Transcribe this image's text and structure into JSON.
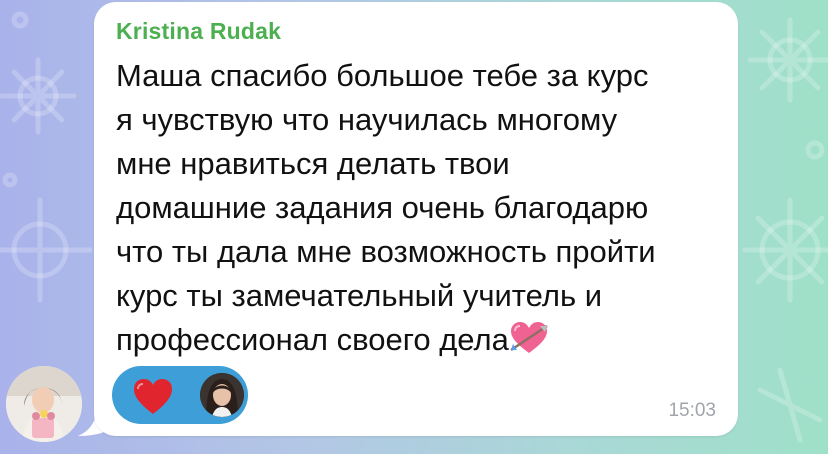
{
  "message": {
    "sender_name": "Kristina Rudak",
    "lines": [
      "Маша спасибо большое тебе за курс",
      "я чувствую что научилась многому",
      "мне нравиться делать твои",
      "домашние задания очень благодарю",
      "что ты дала мне возможность пройти",
      "курс ты замечательный учитель и",
      "профессионал своего дела"
    ],
    "trailing_emoji": "heart-with-arrow-icon",
    "time": "15:03",
    "reaction": {
      "emoji": "red-heart-icon",
      "reactor": "reactor-avatar"
    }
  },
  "colors": {
    "sender_name": "#4caf50",
    "bubble": "#ffffff",
    "reaction_pill": "#3e9fd8",
    "timestamp": "#a0a4ab",
    "heart": "#e0252f",
    "heart_arrow": "#f06292"
  }
}
